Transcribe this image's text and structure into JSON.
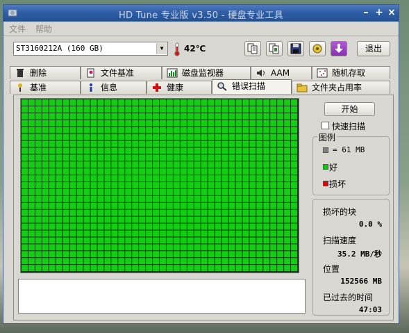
{
  "window": {
    "title": "HD Tune 专业版 v3.50 - 硬盘专业工具"
  },
  "menu": {
    "items": [
      "文件",
      "帮助"
    ]
  },
  "toolbar": {
    "drive": "ST3160212A (160 GB)",
    "temperature": "42℃",
    "exit_label": "退出",
    "buttons": [
      "copy-text-icon",
      "copy-screenshot-icon",
      "save-icon",
      "options-icon",
      "download-icon"
    ]
  },
  "tabs": {
    "top": [
      {
        "label": "删除",
        "icon": "trash-icon"
      },
      {
        "label": "文件基准",
        "icon": "file-benchmark-icon"
      },
      {
        "label": "磁盘监视器",
        "icon": "disk-monitor-icon"
      },
      {
        "label": "AAM",
        "icon": "speaker-icon"
      },
      {
        "label": "随机存取",
        "icon": "random-access-icon"
      }
    ],
    "bottom": [
      {
        "label": "基准",
        "icon": "benchmark-icon"
      },
      {
        "label": "信息",
        "icon": "info-icon"
      },
      {
        "label": "健康",
        "icon": "health-cross-icon"
      },
      {
        "label": "错误扫描",
        "icon": "magnifier-icon",
        "active": true
      },
      {
        "label": "文件夹占用率",
        "icon": "folder-icon"
      }
    ]
  },
  "scan": {
    "start_label": "开始",
    "quick_scan_label": "快速扫描",
    "quick_scan_checked": false,
    "legend": {
      "title": "图例",
      "block_size": "= 61 MB",
      "good": "好",
      "damaged": "损坏",
      "colors": {
        "block": "#808080",
        "good": "#00cc00",
        "damaged": "#e00000"
      }
    },
    "stats": {
      "damaged_blocks_label": "损坏的块",
      "damaged_blocks_value": "0.0 %",
      "scan_speed_label": "扫描速度",
      "scan_speed_value": "35.2 MB/秒",
      "position_label": "位置",
      "position_value": "152566 MB",
      "elapsed_label": "已过去的时间",
      "elapsed_value": "47:03"
    },
    "grid": {
      "columns": 40,
      "rows": 25,
      "good_fraction": 1.0,
      "cell_color": "#11d011"
    }
  }
}
